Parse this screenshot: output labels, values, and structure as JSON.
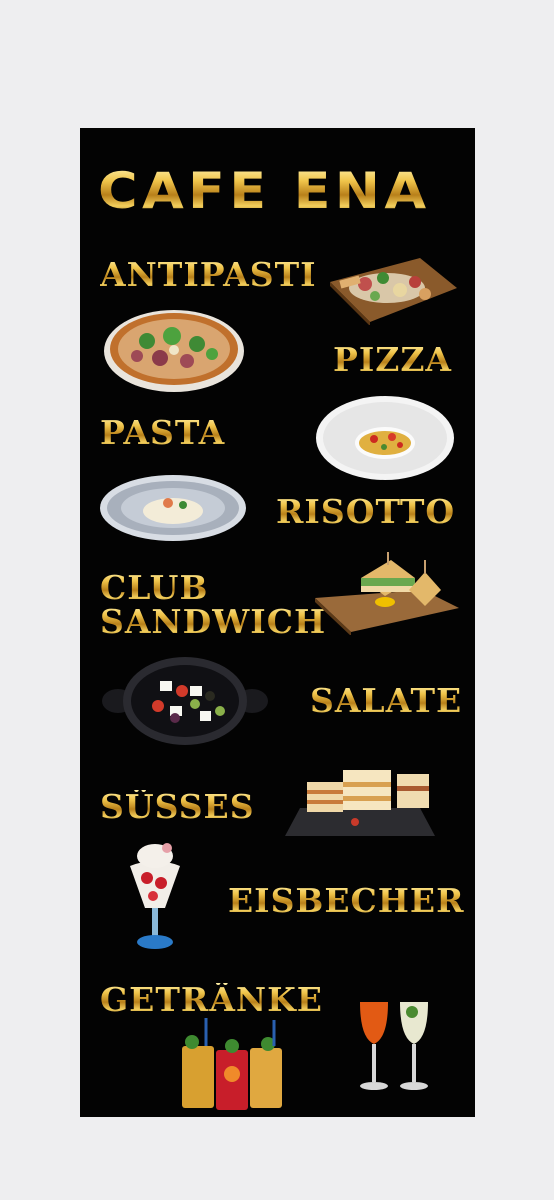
{
  "title": "CAFE ENA",
  "categories": {
    "antipasti": "ANTIPASTI",
    "pizza": "PIZZA",
    "pasta": "PASTA",
    "risotto": "RISOTTO",
    "club_line1": "CLUB",
    "club_line2": "SANDWICH",
    "salate": "SALATE",
    "suesses": "SÜSSES",
    "eisbecher": "EISBECHER",
    "getraenke": "GETRÄNKE"
  },
  "colors": {
    "poster_background": "#030303",
    "page_background": "#eeeef0",
    "gold_light": "#fff0a8",
    "gold_dark": "#b8801a"
  },
  "icons": [
    "antipasti-board-image",
    "pizza-image",
    "pasta-plate-image",
    "risotto-plate-image",
    "club-sandwich-image",
    "salad-pan-image",
    "cake-slices-image",
    "sundae-glass-image",
    "cocktails-image",
    "spritz-glasses-image"
  ]
}
